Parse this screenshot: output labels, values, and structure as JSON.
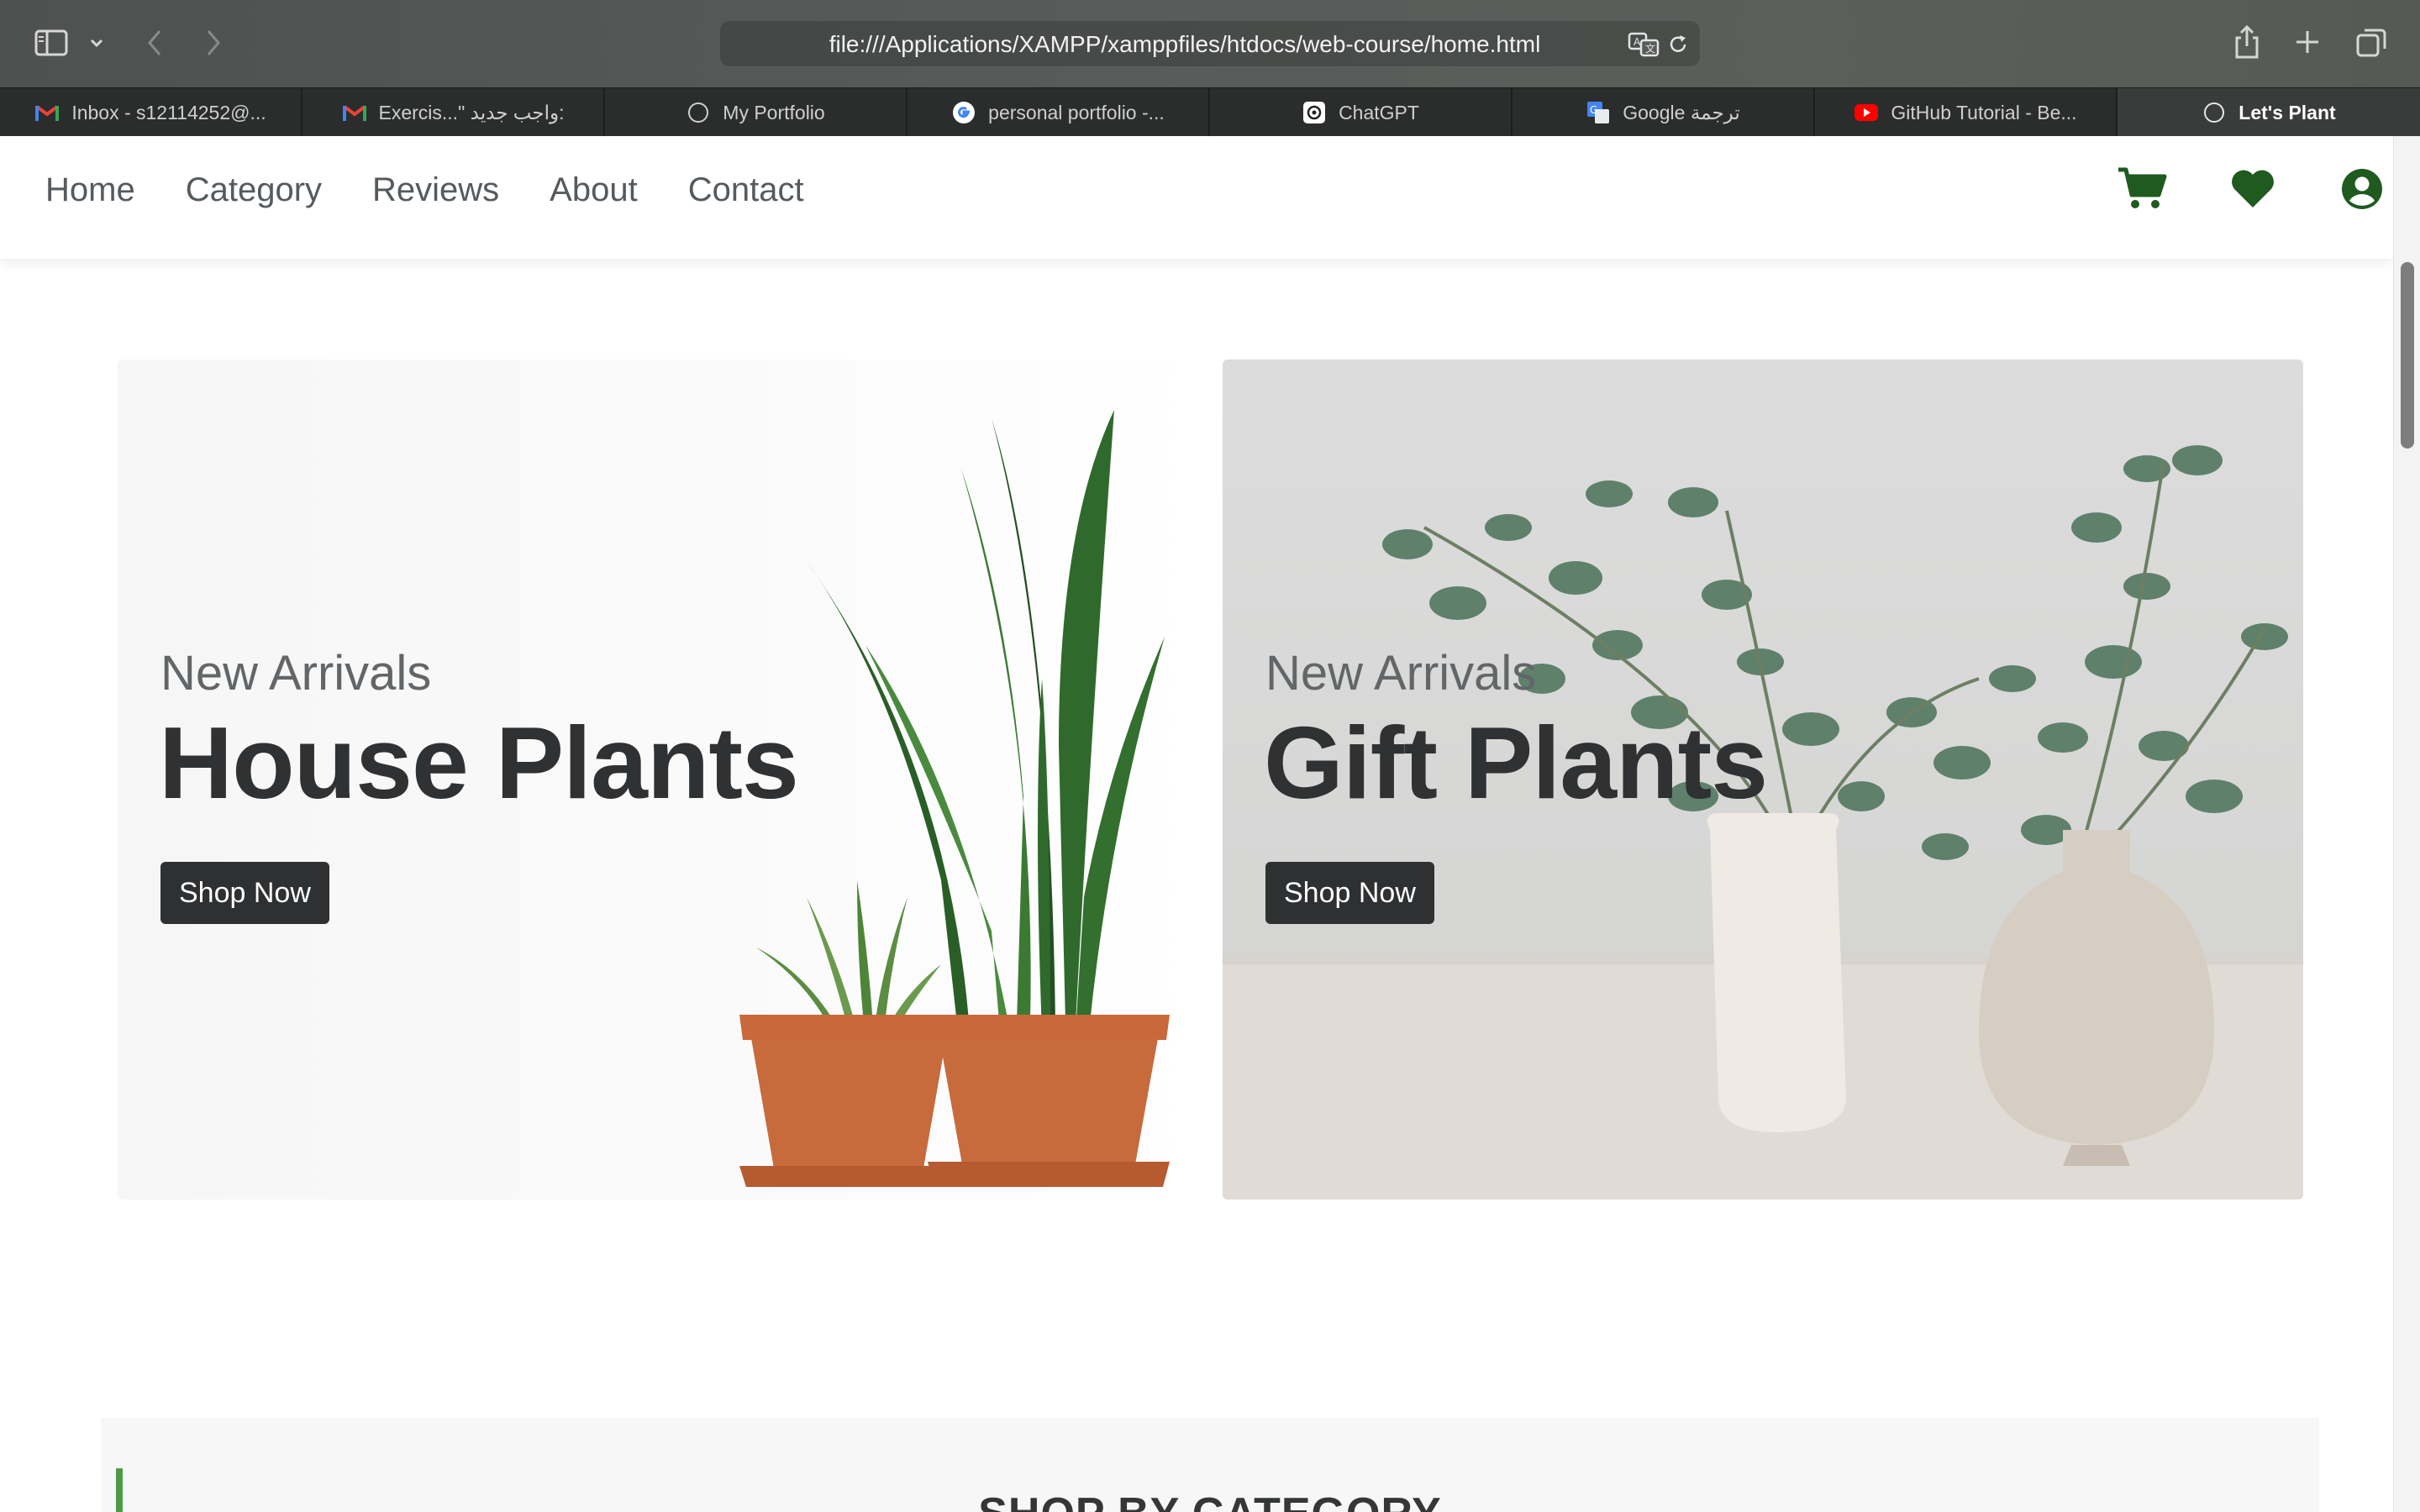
{
  "browser": {
    "url": "file:///Applications/XAMPP/xamppfiles/htdocs/web-course/home.html",
    "tabs": [
      {
        "label": "Inbox - s12114252@...",
        "icon": "gmail-icon"
      },
      {
        "label": "Exercis...\" واجب جديد:",
        "icon": "gmail-icon"
      },
      {
        "label": "My Portfolio",
        "icon": "compass-icon"
      },
      {
        "label": "personal portfolio -...",
        "icon": "google-icon"
      },
      {
        "label": "ChatGPT",
        "icon": "chatgpt-icon"
      },
      {
        "label": "Google ترجمة",
        "icon": "google-translate-icon"
      },
      {
        "label": "GitHub Tutorial - Be...",
        "icon": "youtube-icon"
      },
      {
        "label": "Let's Plant",
        "icon": "compass-icon",
        "active": true
      }
    ]
  },
  "nav": {
    "links": [
      "Home",
      "Category",
      "Reviews",
      "About",
      "Contact"
    ],
    "accent_color": "#1f5a1f"
  },
  "hero": [
    {
      "subtitle": "New Arrivals",
      "title": "House Plants",
      "button": "Shop Now"
    },
    {
      "subtitle": "New Arrivals",
      "title": "Gift Plants",
      "button": "Shop Now"
    }
  ],
  "category_section": {
    "title": "SHOP BY CATEGORY",
    "accent_color": "#4f9a48"
  }
}
